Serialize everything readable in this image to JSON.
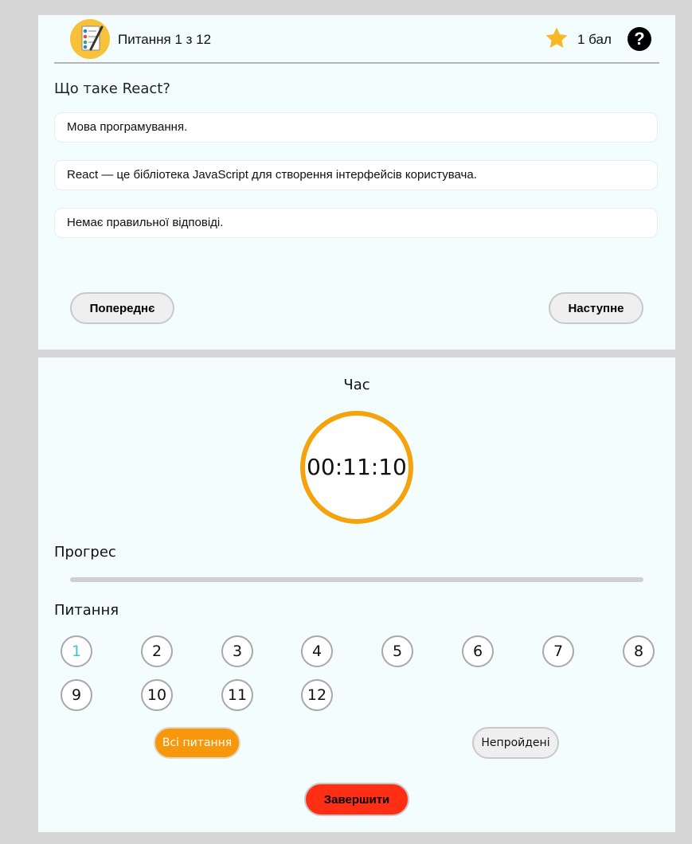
{
  "header": {
    "logo_icon": "quiz-checklist-icon",
    "counter": "Питання 1 з 12",
    "star_icon": "star-icon",
    "score": "1 бал",
    "help_icon": "help-icon",
    "help_symbol": "?"
  },
  "question": {
    "text": "Що таке React?",
    "answers": [
      "Мова програмування.",
      "React — це бібліотека JavaScript для створення інтерфейсів користувача.",
      "Немає правильної відповіді."
    ]
  },
  "navigation": {
    "prev_label": "Попереднє",
    "next_label": "Наступне"
  },
  "timer": {
    "label": "Час",
    "value": "00:11:10"
  },
  "progress": {
    "label": "Прогрес",
    "fraction": 0
  },
  "questions_grid": {
    "label": "Питання",
    "current": 1,
    "items": [
      "1",
      "2",
      "3",
      "4",
      "5",
      "6",
      "7",
      "8",
      "9",
      "10",
      "11",
      "12"
    ]
  },
  "filters": {
    "all_label": "Всі питання",
    "unanswered_label": "Непройдені"
  },
  "finish_label": "Завершити",
  "colors": {
    "accent": "#f5a30c",
    "finish": "#ff2e15",
    "current": "#39c6dc",
    "panel": "#f3fdfe"
  }
}
